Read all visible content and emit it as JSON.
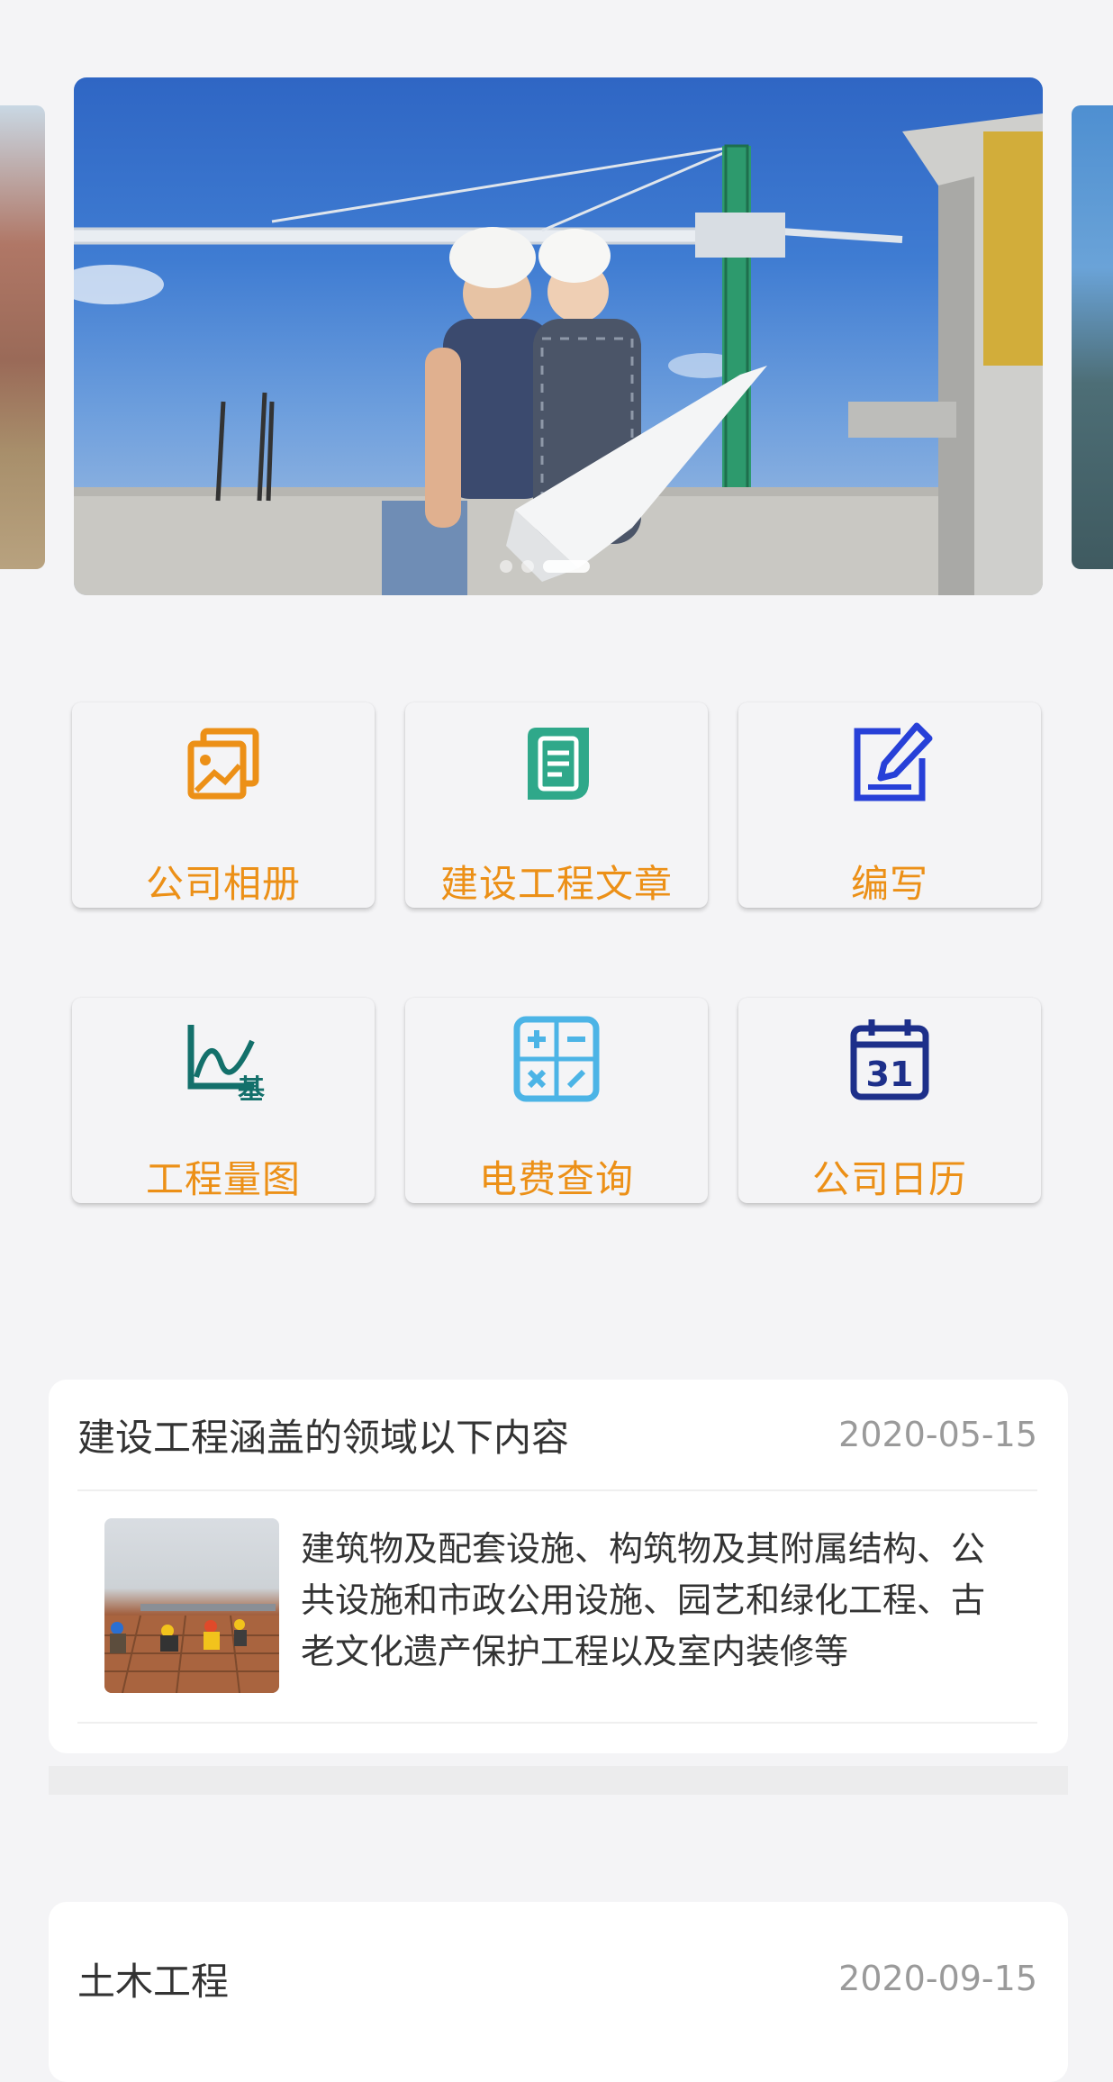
{
  "carousel": {
    "slide_count": 3,
    "active_index": 2
  },
  "grid": {
    "label_color": "#ec9017",
    "items": [
      {
        "label": "公司相册",
        "icon": "photo-album-icon",
        "color": "#ec9017"
      },
      {
        "label": "建设工程文章",
        "icon": "article-document-icon",
        "color": "#2fa88a"
      },
      {
        "label": "编写",
        "icon": "edit-pencil-icon",
        "color": "#2740d8"
      },
      {
        "label": "工程量图",
        "icon": "engineering-chart-icon",
        "color": "#13706b"
      },
      {
        "label": "电费查询",
        "icon": "calculator-icon",
        "color": "#4cb4e6"
      },
      {
        "label": "公司日历",
        "icon": "calendar-icon",
        "color": "#1d2f8a"
      }
    ]
  },
  "articles": [
    {
      "title": "建设工程涵盖的领域以下内容",
      "date": "2020-05-15",
      "summary": "建筑物及配套设施、构筑物及其附属结构、公共设施和市政公用设施、园艺和绿化工程、古老文化遗产保护工程以及室内装修等"
    },
    {
      "title": "土木工程",
      "date": "2020-09-15"
    }
  ]
}
